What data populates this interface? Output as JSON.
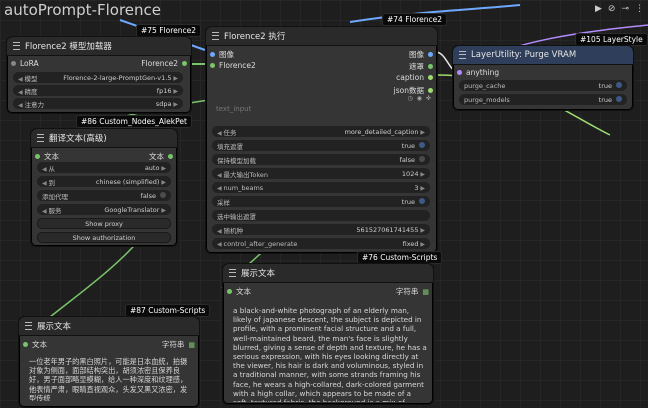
{
  "app": {
    "title": "autoPrompt-Florence"
  },
  "colors": {
    "wire_blue": "#6ea8ff",
    "wire_white": "#e5e5e5",
    "wire_green": "#7ac56b",
    "wire_purple": "#b48cff",
    "node_bg": "#353535"
  },
  "nodes": {
    "loader": {
      "tag": "#75 Florence2",
      "title": "Florence2 模型加载器",
      "inputs": [
        "LoRA"
      ],
      "outputs": [
        "Florence2"
      ],
      "widgets": [
        {
          "label": "模型",
          "value": "Florence-2-large-PromptGen-v1.5"
        },
        {
          "label": "精度",
          "value": "fp16"
        },
        {
          "label": "注意力",
          "value": "sdpa"
        }
      ]
    },
    "exec": {
      "tag": "#74 Florence2",
      "title": "Florence2 执行",
      "inputs": [
        "图像",
        "Florence2"
      ],
      "outputs": [
        "图像",
        "遮罩",
        "caption",
        "json数据"
      ],
      "text_input_placeholder": "text_input",
      "widgets": [
        {
          "label": "任务",
          "value": "more_detailed_caption"
        },
        {
          "label": "填充遮罩",
          "value": "true"
        },
        {
          "label": "保持模型加载",
          "value": "false"
        },
        {
          "label": "最大输出Token",
          "value": "1024"
        },
        {
          "label": "num_beams",
          "value": "3"
        },
        {
          "label": "采样",
          "value": "true"
        },
        {
          "label": "选中输出遮罩",
          "value": ""
        },
        {
          "label": "随机种",
          "value": "561527061741455"
        },
        {
          "label": "control_after_generate",
          "value": "fixed"
        }
      ]
    },
    "purge": {
      "tag": "#105 LayerStyle",
      "title": "LayerUtility: Purge VRAM",
      "inputs": [
        "anything"
      ],
      "widgets": [
        {
          "label": "purge_cache",
          "value": "true"
        },
        {
          "label": "purge_models",
          "value": "true"
        }
      ]
    },
    "translate": {
      "tag": "#86 Custom_Nodes_AlekPet",
      "title": "翻译文本(高级)",
      "inputs": [
        "文本"
      ],
      "outputs": [
        "文本"
      ],
      "widgets": [
        {
          "label": "从",
          "value": "auto"
        },
        {
          "label": "到",
          "value": "chinese (simplified)"
        },
        {
          "label": "添加代理",
          "value": "false"
        },
        {
          "label": "服务",
          "value": "GoogleTranslator"
        }
      ],
      "buttons": [
        "Show proxy",
        "Show authorization"
      ]
    },
    "show_en": {
      "tag": "#76 Custom-Scripts",
      "title": "展示文本",
      "input": "文本",
      "output": "字符串",
      "text": "a black-and-white photograph of an elderly man, likely of japanese descent, the subject is depicted in profile, with a prominent facial structure and a full, well-maintained beard, the man's face is slightly blurred, giving a sense of depth and texture, he has a serious expression, with his eyes looking directly at the viewer, his hair is dark and voluminous, styled in a traditional manner, with some strands framing his face, he wears a high-collared, dark-colored garment with a high collar, which appears to be made of a soft, textured fabric, the background is a mix of beige and brown tones, with visible brushstrokes, suggesting a rough, possibly worn"
    },
    "show_zh": {
      "tag": "#87 Custom-Scripts",
      "title": "展示文本",
      "input": "文本",
      "output": "字符串",
      "text": "一位老年男子的黑白照片，可能是日本血统，拍摄对象为侧面，面部结构突出，胡须浓密且保养良好，男子面部略显模糊，给人一种深度和纹理感，他表情严肃，眼睛直视观众，头发又黑又浓密，发型传统"
    }
  }
}
